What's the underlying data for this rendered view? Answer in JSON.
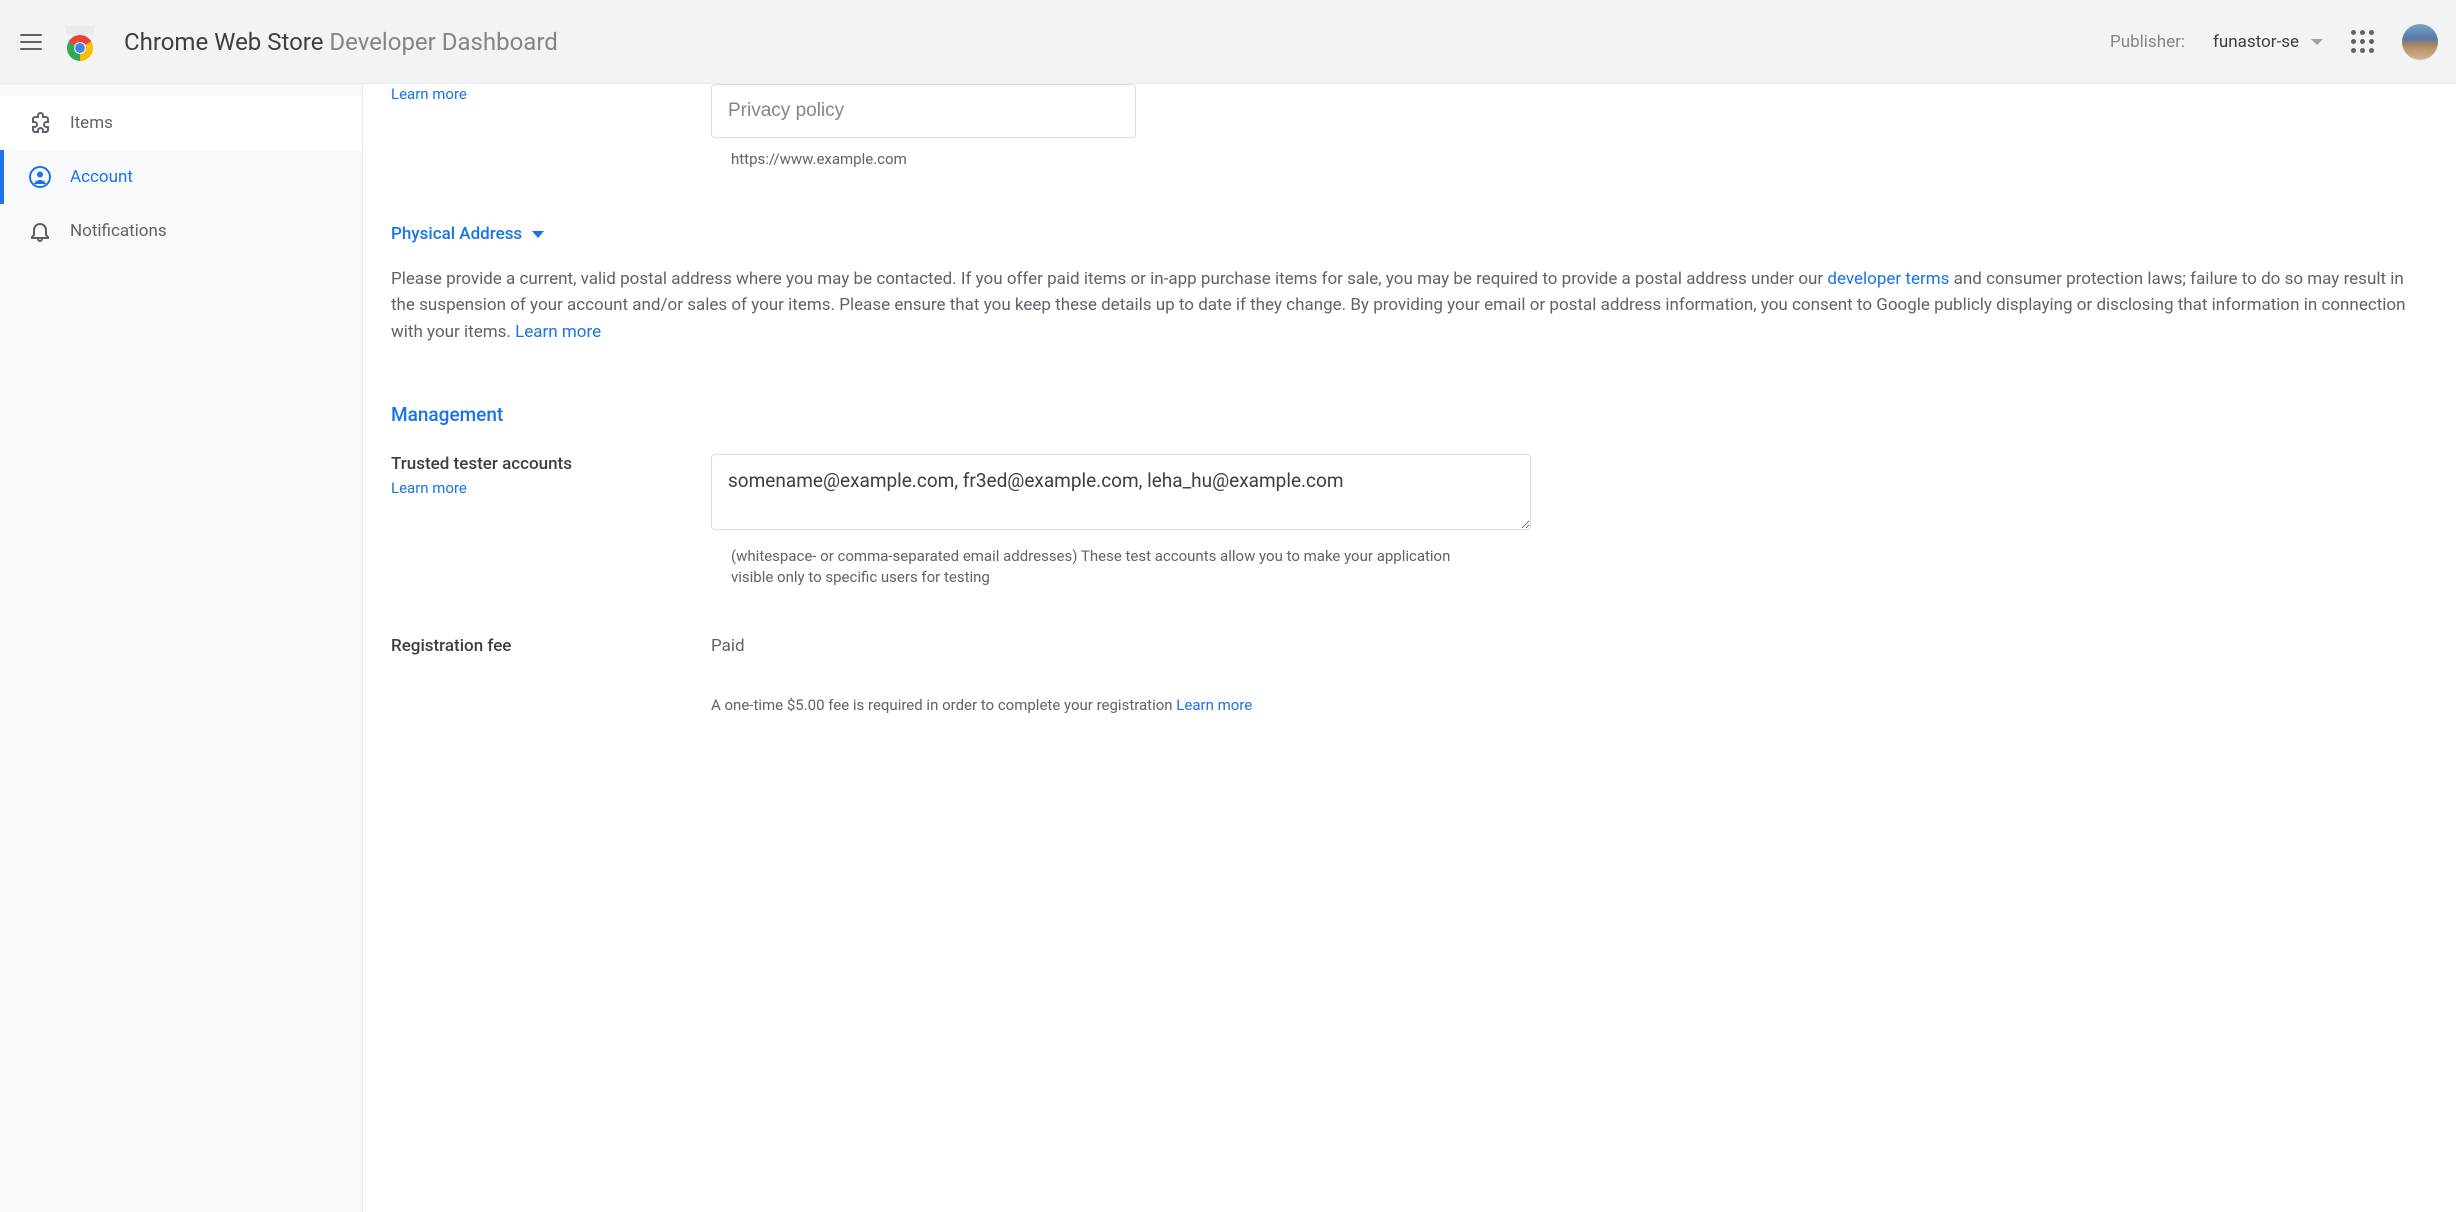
{
  "header": {
    "title_main": "Chrome Web Store",
    "title_sub": "Developer Dashboard",
    "publisher_label": "Publisher:",
    "publisher_value": "funastor-se"
  },
  "sidebar": {
    "items": [
      {
        "label": "Items"
      },
      {
        "label": "Account"
      },
      {
        "label": "Notifications"
      }
    ]
  },
  "privacy": {
    "learn_more": "Learn more",
    "placeholder": "Privacy policy",
    "helper": "https://www.example.com"
  },
  "physical_address": {
    "title": "Physical Address",
    "text_before": "Please provide a current, valid postal address where you may be contacted. If you offer paid items or in-app purchase items for sale, you may be required to provide a postal address under our ",
    "link1": "developer terms",
    "text_mid": " and consumer protection laws; failure to do so may result in the suspension of your account and/or sales of your items. Please ensure that you keep these details up to date if they change. By providing your email or postal address information, you consent to Google publicly displaying or disclosing that information in connection with your items. ",
    "link2": "Learn more"
  },
  "management": {
    "title": "Management",
    "trusted_label": "Trusted tester accounts",
    "trusted_learn": "Learn more",
    "trusted_value": "somename@example.com, fr3ed@example.com, leha_hu@example.com",
    "trusted_helper": "(whitespace- or comma-separated email addresses) These test accounts allow you to make your application visible only to specific users for testing",
    "fee_label": "Registration fee",
    "fee_value": "Paid",
    "fee_helper": "A one-time $5.00 fee is required in order to complete your registration ",
    "fee_learn": "Learn more"
  }
}
